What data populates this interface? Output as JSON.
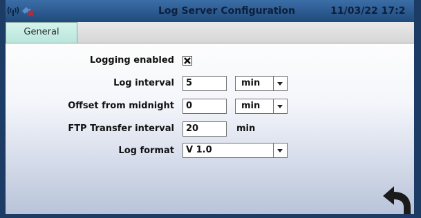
{
  "titlebar": {
    "title": "Log Server Configuration",
    "datetime": "11/03/22 17:2",
    "icons": [
      "network-status-icon",
      "connection-status-icon"
    ]
  },
  "tabs": [
    {
      "label": "General",
      "active": true
    }
  ],
  "form": {
    "logging_enabled": {
      "label": "Logging enabled",
      "checked": true
    },
    "log_interval": {
      "label": "Log interval",
      "value": "5",
      "unit": "min"
    },
    "offset": {
      "label": "Offset from midnight",
      "value": "0",
      "unit": "min"
    },
    "ftp": {
      "label": "FTP Transfer interval",
      "value": "20",
      "unit": "min"
    },
    "log_format": {
      "label": "Log format",
      "value": "V 1.0"
    }
  },
  "icons": {
    "back": "back-arrow-icon"
  },
  "colors": {
    "titlebar": "#2d5a91",
    "tab_active": "#c6ece3",
    "frame": "#1c3c66"
  }
}
